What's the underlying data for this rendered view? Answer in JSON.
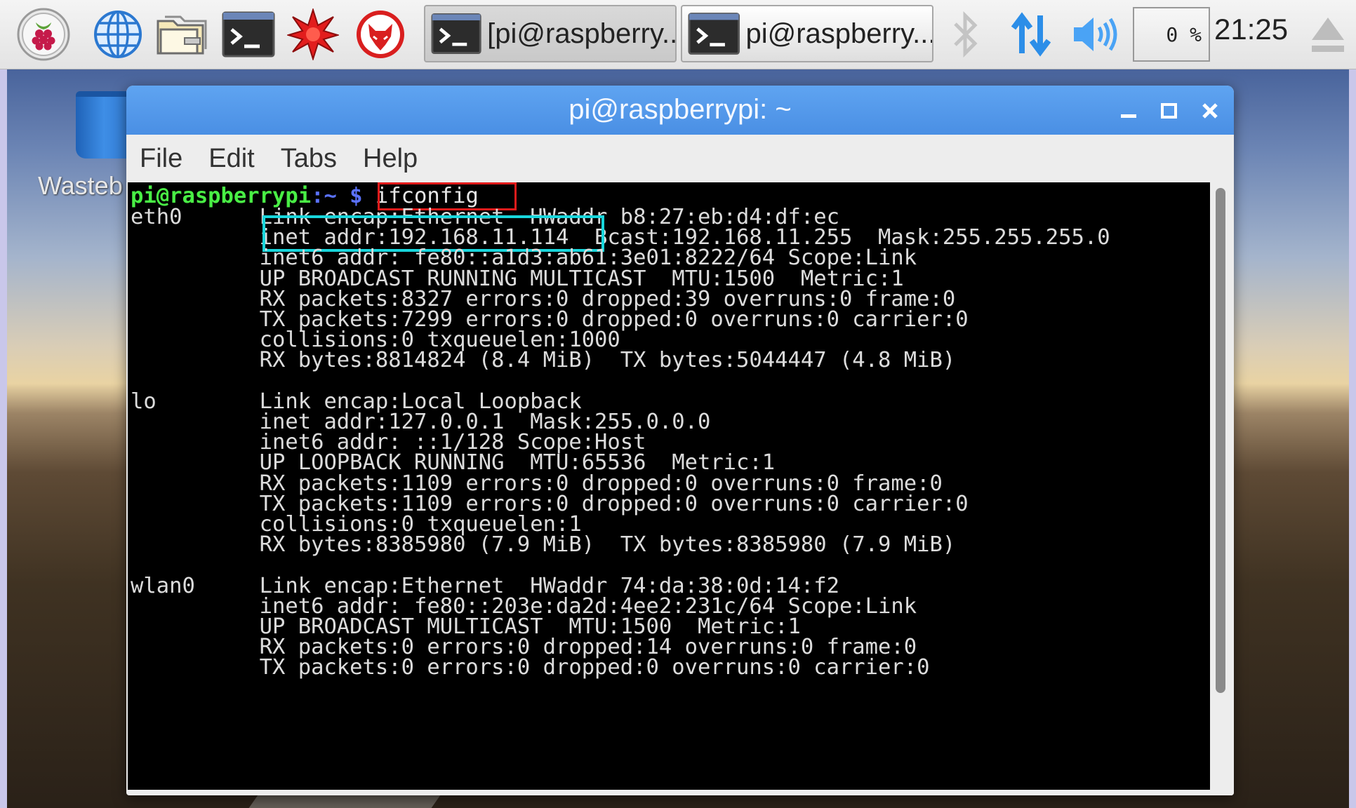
{
  "desktop": {
    "trash_label": "Wasteb"
  },
  "panel": {
    "launchers": [
      {
        "name": "raspberry-menu-icon"
      },
      {
        "name": "web-browser-icon"
      },
      {
        "name": "file-manager-icon"
      },
      {
        "name": "terminal-icon"
      },
      {
        "name": "mathematica-icon"
      },
      {
        "name": "wolfram-icon"
      }
    ],
    "tasks": [
      {
        "label": "[pi@raspberry...",
        "active": true
      },
      {
        "label": "pi@raspberry...",
        "active": false
      }
    ],
    "cpu": "0 %",
    "clock": "21:25",
    "tray_icons": [
      "bluetooth-icon",
      "network-icon",
      "volume-icon",
      "eject-icon"
    ]
  },
  "window": {
    "title": "pi@raspberrypi: ~",
    "controls": [
      "minimize",
      "maximize",
      "close"
    ],
    "menu": [
      "File",
      "Edit",
      "Tabs",
      "Help"
    ]
  },
  "terminal": {
    "prompt_user": "pi@raspberrypi",
    "prompt_path": ":~ $",
    "command": "ifconfig",
    "highlight_command": "ifconfig",
    "highlight_ip": "inet addr:192.168.11.114",
    "lines": [
      "eth0      Link encap:Ethernet  HWaddr b8:27:eb:d4:df:ec",
      "          inet addr:192.168.11.114  Bcast:192.168.11.255  Mask:255.255.255.0",
      "          inet6 addr: fe80::a1d3:ab61:3e01:8222/64 Scope:Link",
      "          UP BROADCAST RUNNING MULTICAST  MTU:1500  Metric:1",
      "          RX packets:8327 errors:0 dropped:39 overruns:0 frame:0",
      "          TX packets:7299 errors:0 dropped:0 overruns:0 carrier:0",
      "          collisions:0 txqueuelen:1000",
      "          RX bytes:8814824 (8.4 MiB)  TX bytes:5044447 (4.8 MiB)",
      "",
      "lo        Link encap:Local Loopback",
      "          inet addr:127.0.0.1  Mask:255.0.0.0",
      "          inet6 addr: ::1/128 Scope:Host",
      "          UP LOOPBACK RUNNING  MTU:65536  Metric:1",
      "          RX packets:1109 errors:0 dropped:0 overruns:0 frame:0",
      "          TX packets:1109 errors:0 dropped:0 overruns:0 carrier:0",
      "          collisions:0 txqueuelen:1",
      "          RX bytes:8385980 (7.9 MiB)  TX bytes:8385980 (7.9 MiB)",
      "",
      "wlan0     Link encap:Ethernet  HWaddr 74:da:38:0d:14:f2",
      "          inet6 addr: fe80::203e:da2d:4ee2:231c/64 Scope:Link",
      "          UP BROADCAST MULTICAST  MTU:1500  Metric:1",
      "          RX packets:0 errors:0 dropped:14 overruns:0 frame:0",
      "          TX packets:0 errors:0 dropped:0 overruns:0 carrier:0"
    ]
  },
  "colors": {
    "titlebar": "#4a8fe4",
    "prompt_user": "#49ee45",
    "prompt_path": "#5b72ff",
    "highlight_command": "#e11b1b",
    "highlight_ip": "#18d6dc"
  }
}
